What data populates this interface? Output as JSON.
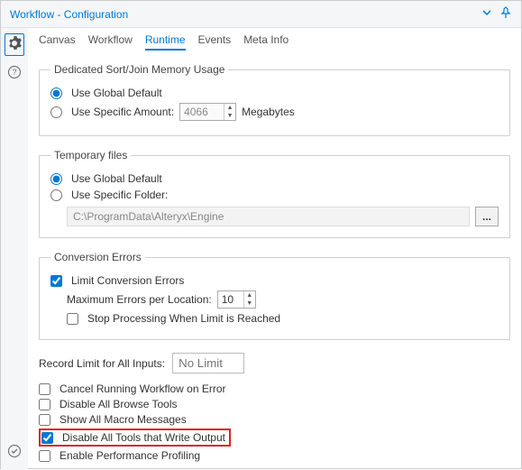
{
  "window": {
    "title": "Workflow - Configuration"
  },
  "tabs": {
    "canvas": "Canvas",
    "workflow": "Workflow",
    "runtime": "Runtime",
    "events": "Events",
    "metainfo": "Meta Info"
  },
  "memory": {
    "legend": "Dedicated Sort/Join Memory Usage",
    "global": "Use Global Default",
    "specific": "Use Specific Amount:",
    "value": "4066",
    "unit": "Megabytes"
  },
  "temp": {
    "legend": "Temporary files",
    "global": "Use Global Default",
    "specific": "Use Specific Folder:",
    "folder": "C:\\ProgramData\\Alteryx\\Engine",
    "browse": "..."
  },
  "conv": {
    "legend": "Conversion Errors",
    "limit": "Limit Conversion Errors",
    "max_label": "Maximum Errors per Location:",
    "max_value": "10",
    "stop": "Stop Processing When Limit is Reached"
  },
  "recordlimit": {
    "label": "Record Limit for All Inputs:",
    "placeholder": "No Limit"
  },
  "options": {
    "cancel": "Cancel Running Workflow on Error",
    "disable_browse": "Disable All Browse Tools",
    "show_macro": "Show All Macro Messages",
    "disable_output": "Disable All Tools that Write Output",
    "profiling": "Enable Performance Profiling"
  }
}
